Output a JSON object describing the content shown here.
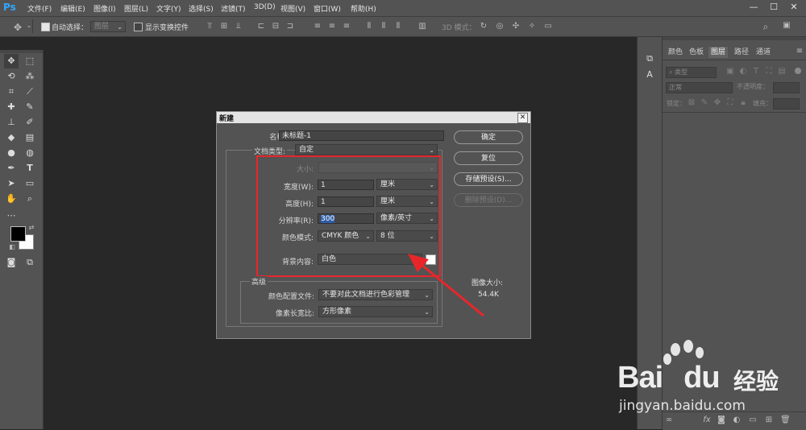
{
  "app": {
    "logo": "Ps"
  },
  "menubar": {
    "items": [
      "文件(F)",
      "编辑(E)",
      "图像(I)",
      "图层(L)",
      "文字(Y)",
      "选择(S)",
      "滤镜(T)",
      "3D(D)",
      "视图(V)",
      "窗口(W)",
      "帮助(H)"
    ],
    "window_controls": [
      "—",
      "☐",
      "✕"
    ]
  },
  "options_bar": {
    "auto_select_label": "自动选择：",
    "auto_select_checked": true,
    "layer_select_value": "图层",
    "show_transform_label": "显示变换控件",
    "mode_3d_label": "3D 模式："
  },
  "panels": {
    "tabs": [
      "颜色",
      "色板",
      "图层",
      "路径",
      "通道"
    ],
    "active_tab": "图层",
    "kind_placeholder": "类型",
    "blend_mode": "正常",
    "opacity_label": "不透明度：",
    "lock_label": "锁定：",
    "fill_label": "填充："
  },
  "dialog": {
    "title": "新建",
    "name_label": "名称(N):",
    "name_value": "未标题-1",
    "doc_type_label": "文档类型:",
    "doc_type_value": "自定",
    "size_label": "大小:",
    "width_label": "宽度(W):",
    "width_value": "1",
    "width_unit": "厘米",
    "height_label": "高度(H):",
    "height_value": "1",
    "height_unit": "厘米",
    "resolution_label": "分辨率(R):",
    "resolution_value": "300",
    "resolution_unit": "像素/英寸",
    "color_mode_label": "颜色模式:",
    "color_mode_value": "CMYK 颜色",
    "bit_depth": "8 位",
    "background_label": "背景内容:",
    "background_value": "白色",
    "advanced_label": "高级",
    "color_profile_label": "颜色配置文件:",
    "color_profile_value": "不要对此文档进行色彩管理",
    "pixel_aspect_label": "像素长宽比:",
    "pixel_aspect_value": "方形像素",
    "image_size_label": "图像大小:",
    "image_size_value": "54.4K",
    "ok_button": "确定",
    "reset_button": "复位",
    "save_preset_button": "存储预设(S)...",
    "delete_preset_button": "删除预设(D)...",
    "close_glyph": "✕"
  },
  "watermark": {
    "brand": "Bai",
    "brand_du": "du",
    "product": "经验",
    "url": "jingyan.baidu.com"
  },
  "colors": {
    "annotation_red": "#e8262a",
    "ps_blue": "#31a8ff"
  }
}
